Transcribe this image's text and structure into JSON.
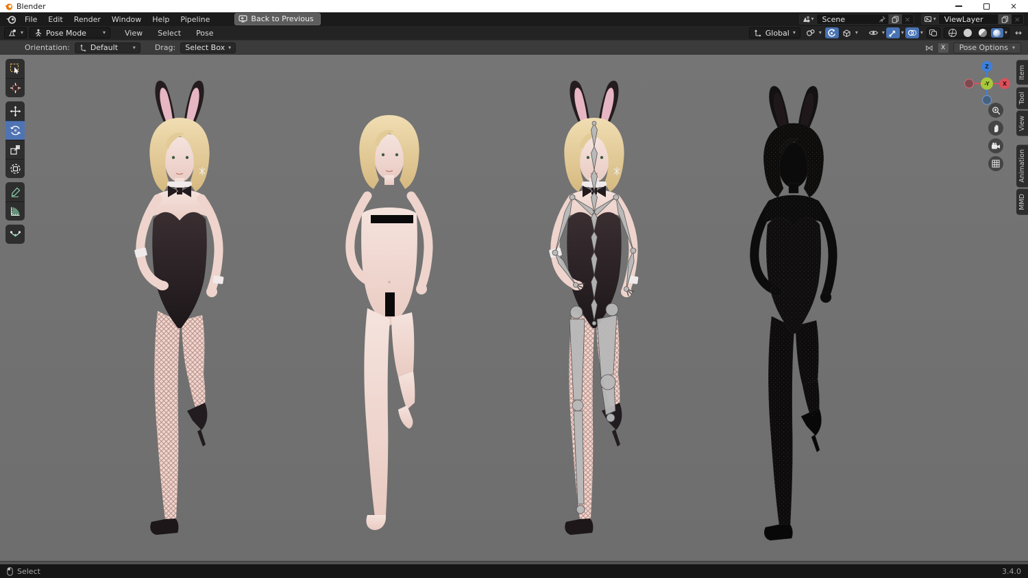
{
  "window": {
    "title": "Blender"
  },
  "menubar": {
    "menus": [
      "File",
      "Edit",
      "Render",
      "Window",
      "Help",
      "Pipeline"
    ],
    "back_button": "Back to Previous",
    "scene_name": "Scene",
    "viewlayer_name": "ViewLayer"
  },
  "viewport_header": {
    "mode": "Pose Mode",
    "menus": [
      "View",
      "Select",
      "Pose"
    ],
    "transform_orientation": "Global"
  },
  "tool_settings": {
    "orientation_label": "Orientation:",
    "orientation_value": "Default",
    "drag_label": "Drag:",
    "drag_value": "Select Box",
    "mirror_axis": "X",
    "pose_options_label": "Pose Options"
  },
  "sidebar_tabs": [
    "Item",
    "Tool",
    "View",
    "Animation",
    "MMD"
  ],
  "gizmo_axes": {
    "z": "Z",
    "neg_y": "-Y",
    "x": "X"
  },
  "statusbar": {
    "hint": "Select",
    "version": "3.4.0"
  },
  "figures": [
    {
      "name": "bunny-suit-textured-model"
    },
    {
      "name": "base-body-censored-model"
    },
    {
      "name": "bunny-suit-armature-model"
    },
    {
      "name": "wireframe-model"
    }
  ],
  "colors": {
    "accent_blue": "#4772b3",
    "viewport_gray": "#727272",
    "axis_x_red": "#d9515c",
    "axis_z_blue": "#3e80d8",
    "axis_y_green": "#a7c83b"
  }
}
